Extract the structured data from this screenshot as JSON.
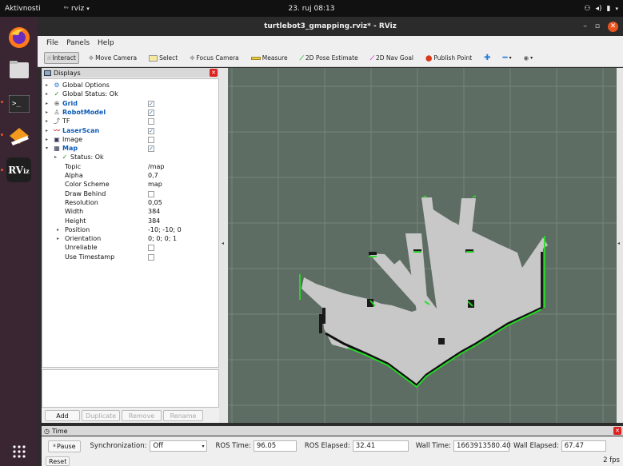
{
  "topbar": {
    "activities": "Aktivnosti",
    "app_name": "rviz",
    "clock": "23. ruj  08:13"
  },
  "window": {
    "title": "turtlebot3_gmapping.rviz* - RViz"
  },
  "menu": {
    "items": [
      "File",
      "Panels",
      "Help"
    ]
  },
  "toolbar": {
    "interact": "Interact",
    "move_camera": "Move Camera",
    "select": "Select",
    "focus_camera": "Focus Camera",
    "measure": "Measure",
    "pose_estimate": "2D Pose Estimate",
    "nav_goal": "2D Nav Goal",
    "publish_point": "Publish Point"
  },
  "displays": {
    "title": "Displays",
    "rows": {
      "global_options": "Global Options",
      "global_status": "Global Status: Ok",
      "grid": "Grid",
      "robot_model": "RobotModel",
      "tf": "TF",
      "laser_scan": "LaserScan",
      "image": "Image",
      "map": "Map",
      "map_status": "Status: Ok",
      "topic": {
        "label": "Topic",
        "value": "/map"
      },
      "alpha": {
        "label": "Alpha",
        "value": "0,7"
      },
      "color_scheme": {
        "label": "Color Scheme",
        "value": "map"
      },
      "draw_behind": {
        "label": "Draw Behind"
      },
      "resolution": {
        "label": "Resolution",
        "value": "0,05"
      },
      "width": {
        "label": "Width",
        "value": "384"
      },
      "height": {
        "label": "Height",
        "value": "384"
      },
      "position": {
        "label": "Position",
        "value": "-10; -10; 0"
      },
      "orientation": {
        "label": "Orientation",
        "value": "0; 0; 0; 1"
      },
      "unreliable": {
        "label": "Unreliable"
      },
      "use_timestamp": {
        "label": "Use Timestamp"
      }
    },
    "buttons": {
      "add": "Add",
      "duplicate": "Duplicate",
      "remove": "Remove",
      "rename": "Rename"
    }
  },
  "time": {
    "title": "Time",
    "pause": "Pause",
    "sync_label": "Synchronization:",
    "sync_value": "Off",
    "ros_time_label": "ROS Time:",
    "ros_time": "96.05",
    "ros_elapsed_label": "ROS Elapsed:",
    "ros_elapsed": "32.41",
    "wall_time_label": "Wall Time:",
    "wall_time": "1663913580.40",
    "wall_elapsed_label": "Wall Elapsed:",
    "wall_elapsed": "67.47",
    "reset": "Reset",
    "fps": "2 fps"
  },
  "colors": {
    "accent": "#e95420",
    "grid_bg": "#5e6d63",
    "map_free": "#c8c8c8",
    "laser": "#22dd22",
    "link_blue": "#0d5bb5"
  }
}
